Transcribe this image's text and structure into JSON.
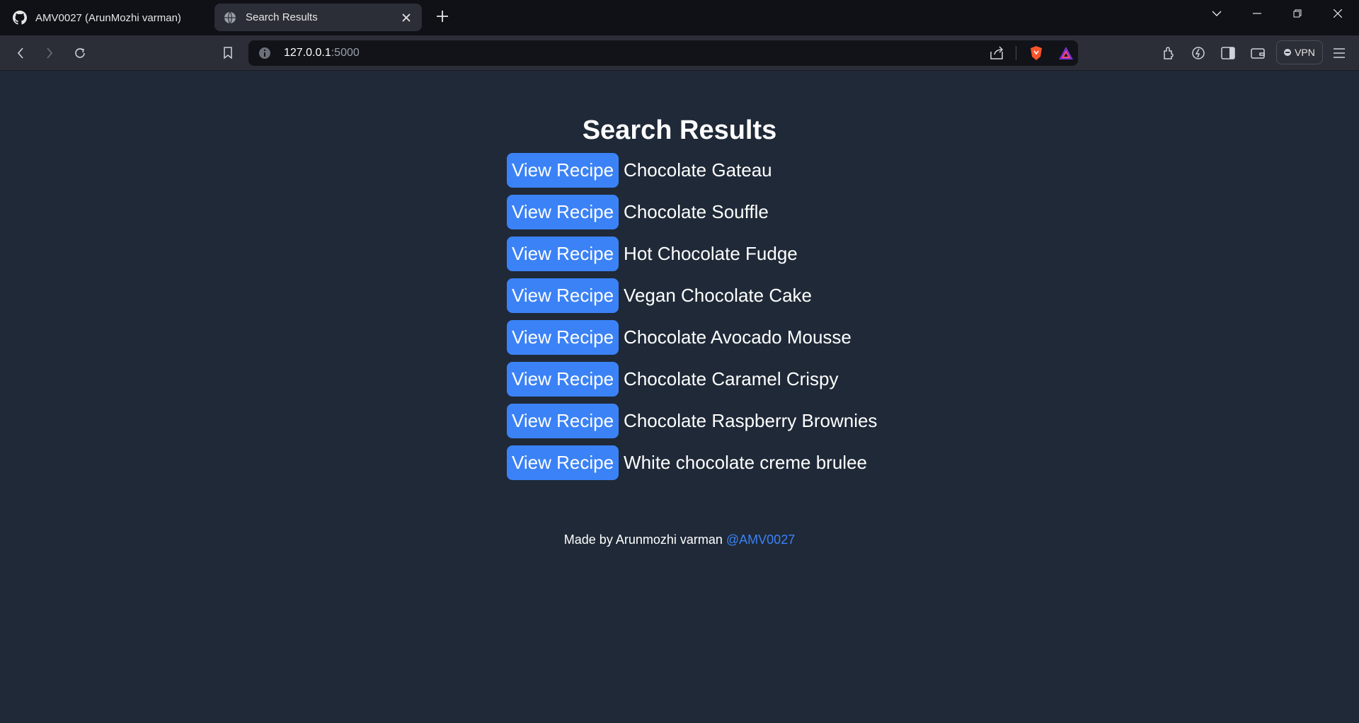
{
  "browser": {
    "tabs": [
      {
        "label": "AMV0027 (ArunMozhi varman)",
        "icon": "github-icon"
      },
      {
        "label": "Search Results",
        "icon": "globe-icon"
      }
    ],
    "url_host": "127.0.0.1",
    "url_port": ":5000",
    "vpn_label": "VPN"
  },
  "page": {
    "title": "Search Results",
    "button_label": "View Recipe",
    "results": [
      "Chocolate Gateau",
      "Chocolate Souffle",
      "Hot Chocolate Fudge",
      "Vegan Chocolate Cake",
      "Chocolate Avocado Mousse",
      "Chocolate Caramel Crispy",
      "Chocolate Raspberry Brownies",
      "White chocolate creme brulee"
    ],
    "footer_text": "Made by Arunmozhi varman ",
    "footer_link": "@AMV0027"
  },
  "colors": {
    "background": "#1f2937",
    "button": "#3b82f6",
    "link": "#3b82f6"
  }
}
